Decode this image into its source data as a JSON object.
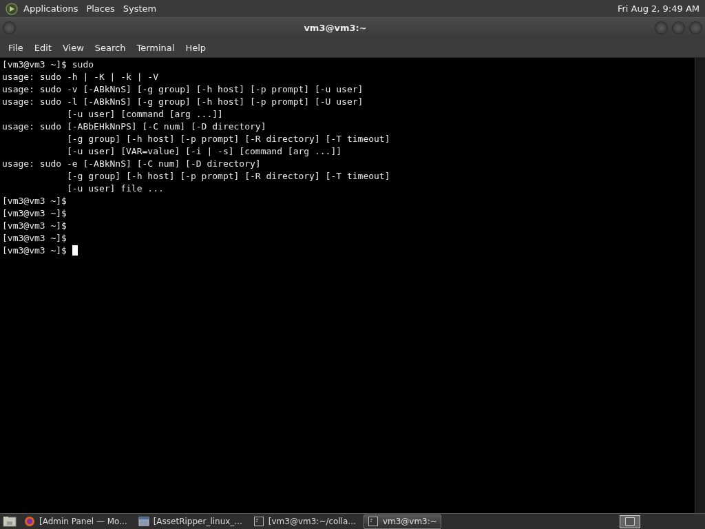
{
  "top_panel": {
    "menus": [
      "Applications",
      "Places",
      "System"
    ],
    "clock": "Fri Aug  2,  9:49 AM"
  },
  "window": {
    "title": "vm3@vm3:~"
  },
  "menu_bar": [
    "File",
    "Edit",
    "View",
    "Search",
    "Terminal",
    "Help"
  ],
  "terminal": {
    "lines": [
      "[vm3@vm3 ~]$ sudo",
      "usage: sudo -h | -K | -k | -V",
      "usage: sudo -v [-ABkNnS] [-g group] [-h host] [-p prompt] [-u user]",
      "usage: sudo -l [-ABkNnS] [-g group] [-h host] [-p prompt] [-U user]",
      "            [-u user] [command [arg ...]]",
      "usage: sudo [-ABbEHkNnPS] [-C num] [-D directory]",
      "            [-g group] [-h host] [-p prompt] [-R directory] [-T timeout]",
      "            [-u user] [VAR=value] [-i | -s] [command [arg ...]]",
      "usage: sudo -e [-ABkNnS] [-C num] [-D directory]",
      "            [-g group] [-h host] [-p prompt] [-R directory] [-T timeout]",
      "            [-u user] file ...",
      "[vm3@vm3 ~]$",
      "[vm3@vm3 ~]$",
      "[vm3@vm3 ~]$",
      "[vm3@vm3 ~]$",
      "[vm3@vm3 ~]$ "
    ]
  },
  "taskbar": {
    "windows": [
      {
        "kind": "browser",
        "label": "[Admin Panel — Mo...",
        "selected": false
      },
      {
        "kind": "files",
        "label": "[AssetRipper_linux_...",
        "selected": false
      },
      {
        "kind": "terminal",
        "label": "[vm3@vm3:~/colla...",
        "selected": false
      },
      {
        "kind": "terminal",
        "label": "vm3@vm3:~",
        "selected": true
      }
    ]
  }
}
